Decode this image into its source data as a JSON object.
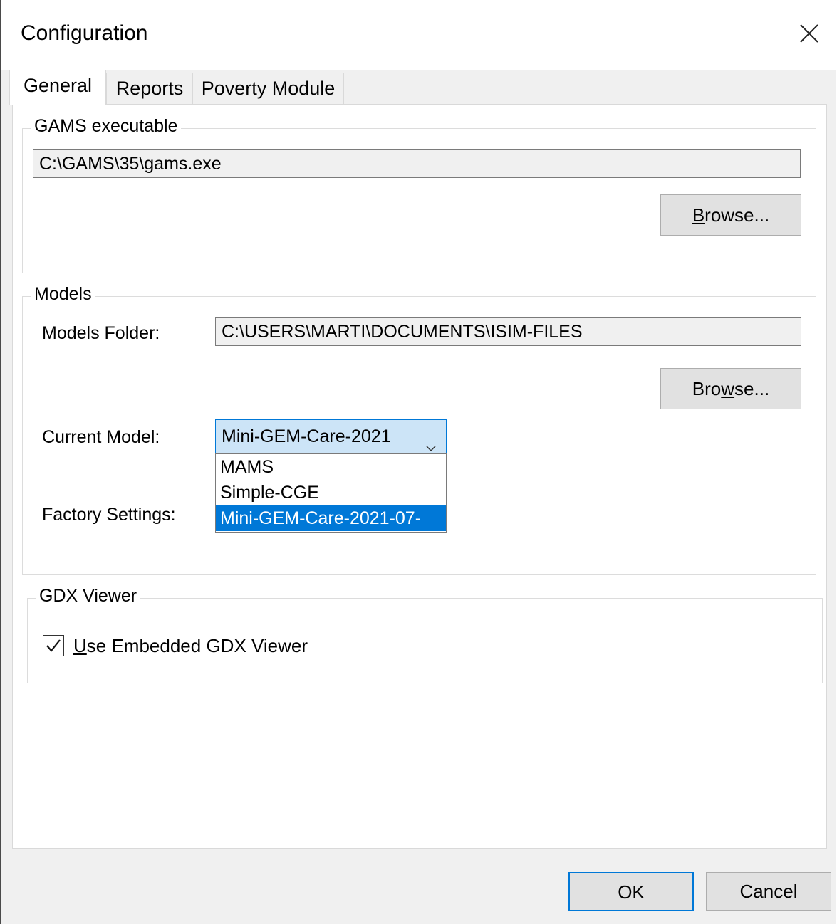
{
  "window": {
    "title": "Configuration"
  },
  "tabs": [
    {
      "label": "General",
      "active": true
    },
    {
      "label": "Reports",
      "active": false
    },
    {
      "label": "Poverty Module",
      "active": false
    }
  ],
  "gams": {
    "legend": "GAMS executable",
    "path": "C:\\GAMS\\35\\gams.exe",
    "browse_label": "Browse...",
    "browse_mnemonic": "B"
  },
  "models": {
    "legend": "Models",
    "folder_label": "Models Folder:",
    "folder_value": "C:\\USERS\\MARTI\\DOCUMENTS\\ISIM-FILES",
    "browse_label_pre": "Bro",
    "browse_label_mn": "w",
    "browse_label_post": "se...",
    "current_label": "Current Model:",
    "current_value": "Mini-GEM-Care-2021",
    "options": [
      "MAMS",
      "Simple-CGE",
      "Mini-GEM-Care-2021-07-"
    ],
    "selected_index": 2,
    "factory_label": "Factory Settings:"
  },
  "gdx": {
    "legend": "GDX Viewer",
    "checkbox_mn": "U",
    "checkbox_rest": "se Embedded GDX Viewer",
    "checked": true
  },
  "footer": {
    "ok_label": "OK",
    "cancel_label": "Cancel"
  },
  "colors": {
    "accent": "#0078d7",
    "combo_bg": "#cce4f7",
    "button_bg": "#e1e1e1"
  }
}
